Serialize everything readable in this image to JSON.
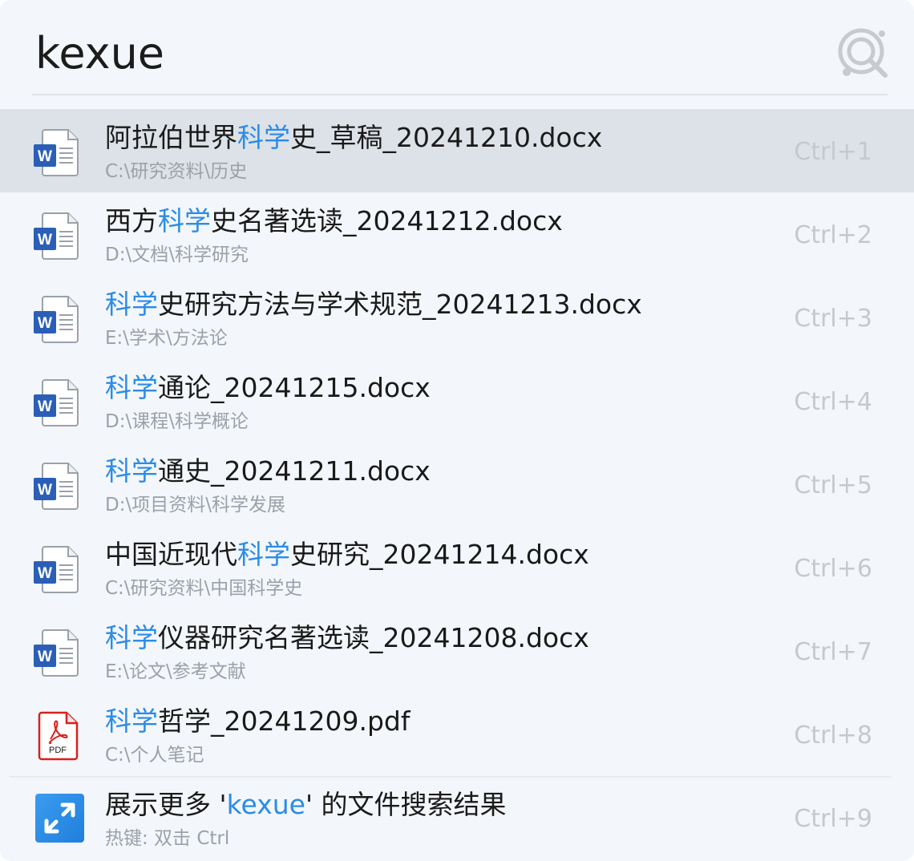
{
  "search": {
    "query": "kexue"
  },
  "results": [
    {
      "type": "word",
      "title_pre": "阿拉伯世界",
      "title_hl": "科学",
      "title_post": "史_草稿_20241210.docx",
      "path": "C:\\研究资料\\历史",
      "shortcut": "Ctrl+1",
      "selected": true
    },
    {
      "type": "word",
      "title_pre": "西方",
      "title_hl": "科学",
      "title_post": "史名著选读_20241212.docx",
      "path": "D:\\文档\\科学研究",
      "shortcut": "Ctrl+2",
      "selected": false
    },
    {
      "type": "word",
      "title_pre": "",
      "title_hl": "科学",
      "title_post": "史研究方法与学术规范_20241213.docx",
      "path": "E:\\学术\\方法论",
      "shortcut": "Ctrl+3",
      "selected": false
    },
    {
      "type": "word",
      "title_pre": "",
      "title_hl": "科学",
      "title_post": "通论_20241215.docx",
      "path": "D:\\课程\\科学概论",
      "shortcut": "Ctrl+4",
      "selected": false
    },
    {
      "type": "word",
      "title_pre": "",
      "title_hl": "科学",
      "title_post": "通史_20241211.docx",
      "path": "D:\\项目资料\\科学发展",
      "shortcut": "Ctrl+5",
      "selected": false
    },
    {
      "type": "word",
      "title_pre": "中国近现代",
      "title_hl": "科学",
      "title_post": "史研究_20241214.docx",
      "path": "C:\\研究资料\\中国科学史",
      "shortcut": "Ctrl+6",
      "selected": false
    },
    {
      "type": "word",
      "title_pre": "",
      "title_hl": "科学",
      "title_post": "仪器研究名著选读_20241208.docx",
      "path": "E:\\论文\\参考文献",
      "shortcut": "Ctrl+7",
      "selected": false
    },
    {
      "type": "pdf",
      "title_pre": "",
      "title_hl": "科学",
      "title_post": "哲学_20241209.pdf",
      "path": "C:\\个人笔记",
      "shortcut": "Ctrl+8",
      "selected": false
    }
  ],
  "more": {
    "title_pre": "展示更多 '",
    "title_hl": "kexue",
    "title_post": "' 的文件搜索结果",
    "hint": "热键: 双击 Ctrl",
    "shortcut": "Ctrl+9"
  },
  "icons": {
    "word_label": "W",
    "pdf_label": "PDF",
    "word_color": "#2b5fb7",
    "pdf_color": "#d9201e",
    "expand_color": "#2b8ce6",
    "highlight_color": "#2b8ce6"
  }
}
